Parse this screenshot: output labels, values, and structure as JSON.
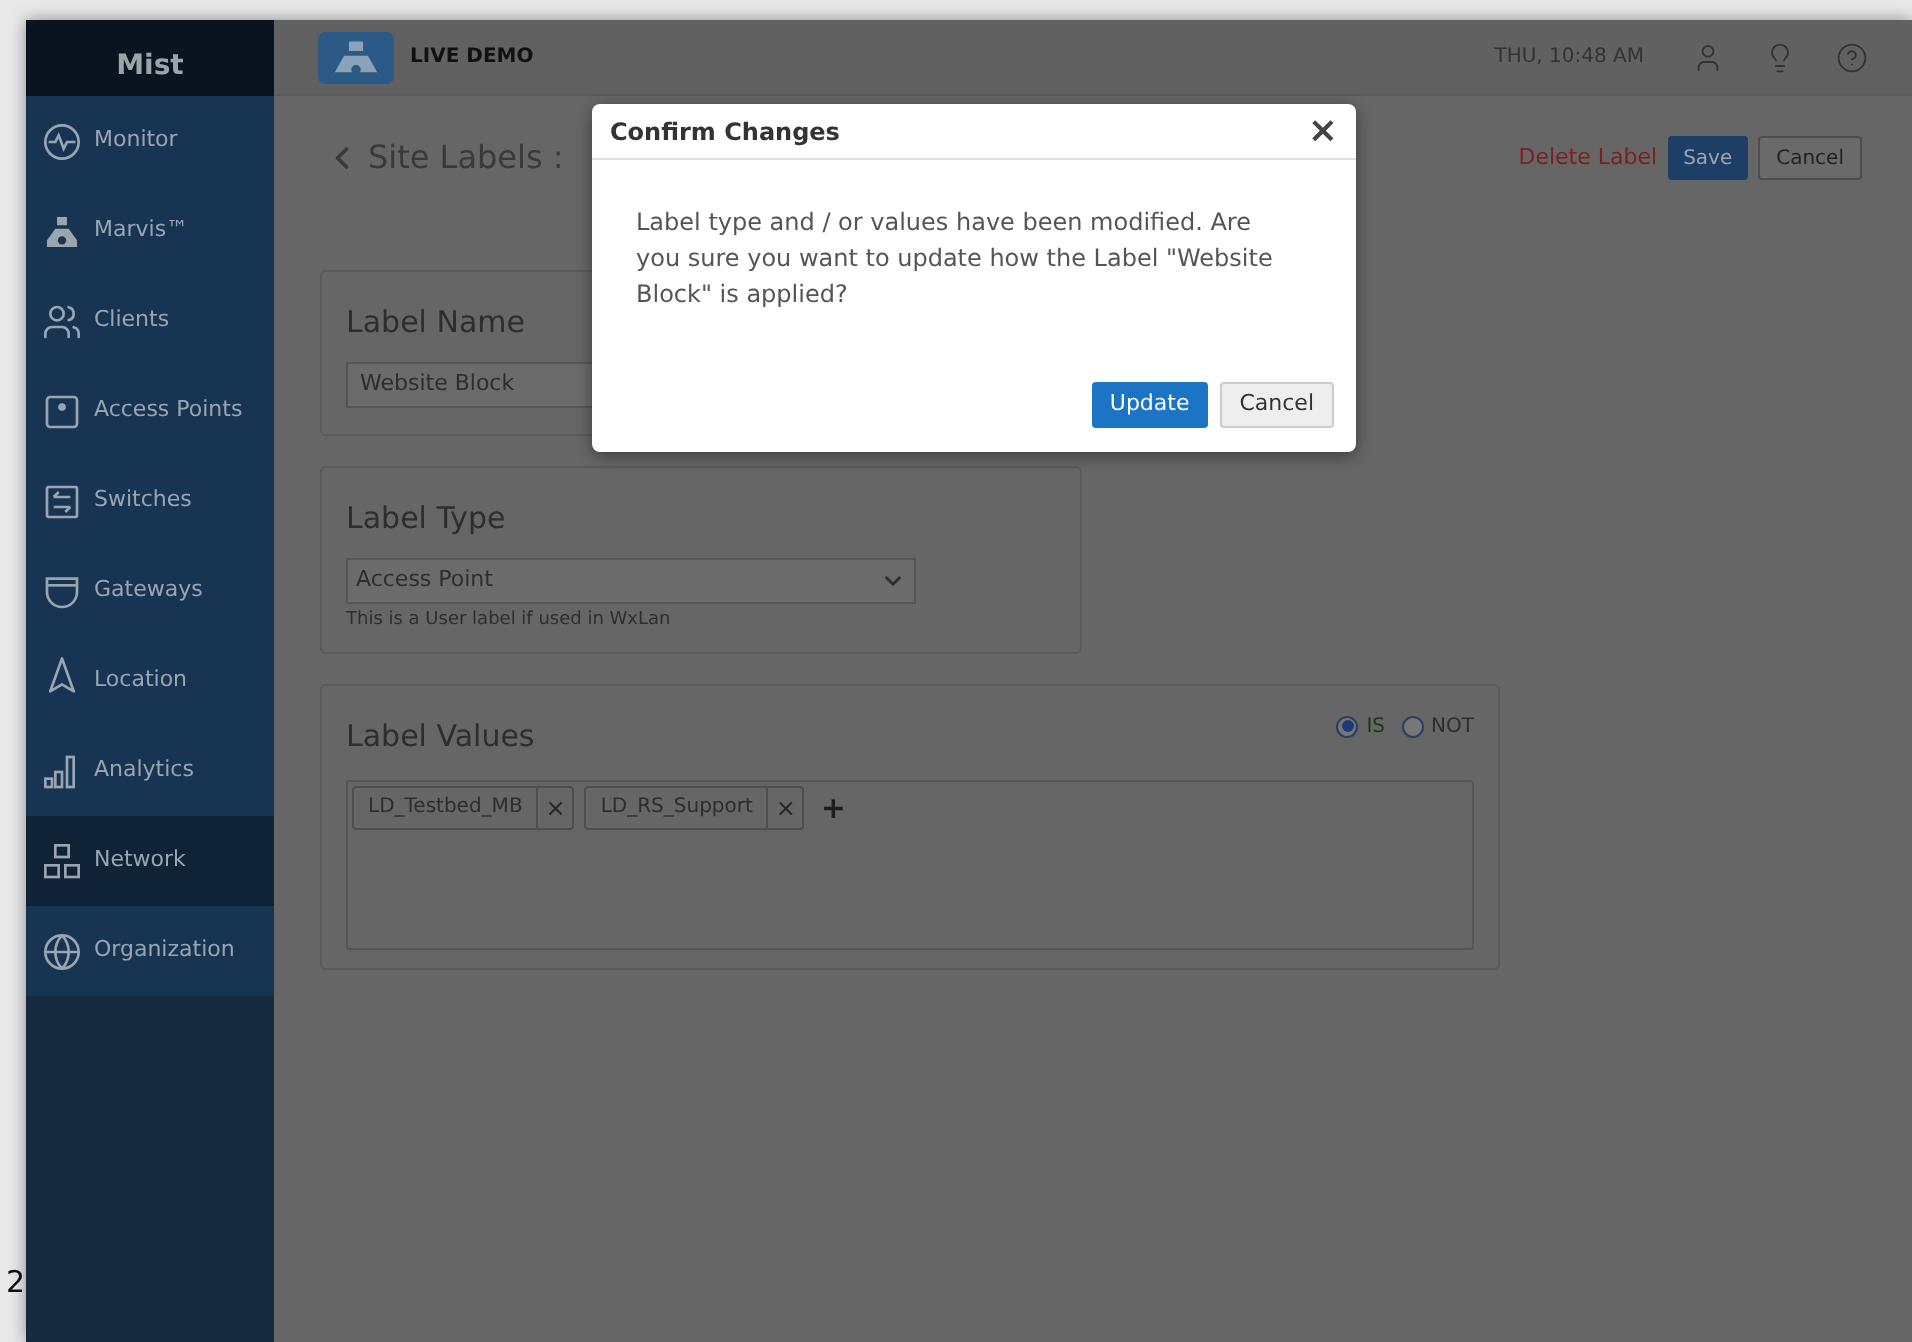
{
  "backdrop_text": "2",
  "sidebar": {
    "logo": "Mist",
    "items": [
      {
        "label": "Monitor",
        "selected": false
      },
      {
        "label": "Marvis™",
        "selected": false
      },
      {
        "label": "Clients",
        "selected": false
      },
      {
        "label": "Access Points",
        "selected": false
      },
      {
        "label": "Switches",
        "selected": false
      },
      {
        "label": "Gateways",
        "selected": false
      },
      {
        "label": "Location",
        "selected": false
      },
      {
        "label": "Analytics",
        "selected": false
      },
      {
        "label": "Network",
        "selected": true
      },
      {
        "label": "Organization",
        "selected": false
      }
    ]
  },
  "header": {
    "badge": "LIVE DEMO",
    "time": "THU, 10:48 AM"
  },
  "page": {
    "breadcrumb": "Site Labels :",
    "delete": "Delete Label",
    "save": "Save",
    "cancel": "Cancel"
  },
  "label_name": {
    "title": "Label Name",
    "value": "Website Block"
  },
  "label_type": {
    "title": "Label Type",
    "value": "Access Point",
    "hint": "This is a User label if used in WxLan"
  },
  "label_values": {
    "title": "Label Values",
    "options": [
      {
        "label": "IS",
        "selected": true
      },
      {
        "label": "NOT",
        "selected": false
      }
    ],
    "tags": [
      {
        "label": "LD_Testbed_MB",
        "remove": "×"
      },
      {
        "label": "LD_RS_Support",
        "remove": "×"
      }
    ],
    "add": "+"
  },
  "dialog": {
    "title": "Confirm Changes",
    "close": "×",
    "message": "Label type and / or values have been modified. Are you sure you want to update how the Label \"Website Block\" is applied?",
    "buttons": [
      {
        "label": "Update",
        "kind": "primary"
      },
      {
        "label": "Cancel",
        "kind": "secondary"
      }
    ]
  }
}
